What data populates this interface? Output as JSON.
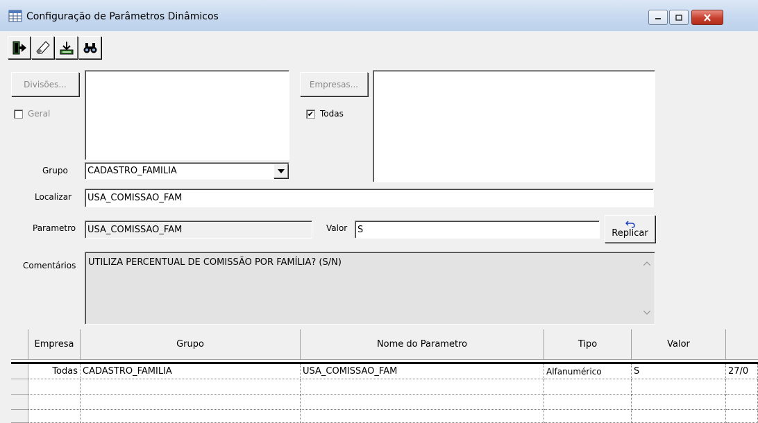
{
  "window": {
    "title": "Configuração de Parâmetros Dinâmicos",
    "minimize_label": "‒",
    "maximize_label": "□",
    "close_label": "✕"
  },
  "toolbar": {
    "buttons": [
      {
        "name": "exit-icon"
      },
      {
        "name": "eraser-icon"
      },
      {
        "name": "save-download-icon"
      },
      {
        "name": "binoculars-icon"
      }
    ]
  },
  "filters": {
    "divisoes_button": "Divisões...",
    "geral_label": "Geral",
    "geral_checked": false,
    "empresas_button": "Empresas...",
    "todas_label": "Todas",
    "todas_checked": true,
    "grupo_label": "Grupo",
    "grupo_value": "CADASTRO_FAMILIA",
    "localizar_label": "Localizar",
    "localizar_value": "USA_COMISSAO_FAM"
  },
  "detail": {
    "parametro_label": "Parametro",
    "parametro_value": "USA_COMISSAO_FAM",
    "valor_label": "Valor",
    "valor_value": "S",
    "replicar_label": "Replicar",
    "comentarios_label": "Comentários",
    "comentarios_value": "UTILIZA PERCENTUAL DE COMISSÃO POR FAMÍLIA? (S/N)"
  },
  "grid": {
    "headers": [
      "Empresa",
      "Grupo",
      "Nome do Parametro",
      "Tipo",
      "Valor",
      ""
    ],
    "rows": [
      [
        "Todas",
        "CADASTRO_FAMILIA",
        "USA_COMISSAO_FAM",
        "Alfanumérico",
        "S",
        "27/0"
      ]
    ]
  }
}
